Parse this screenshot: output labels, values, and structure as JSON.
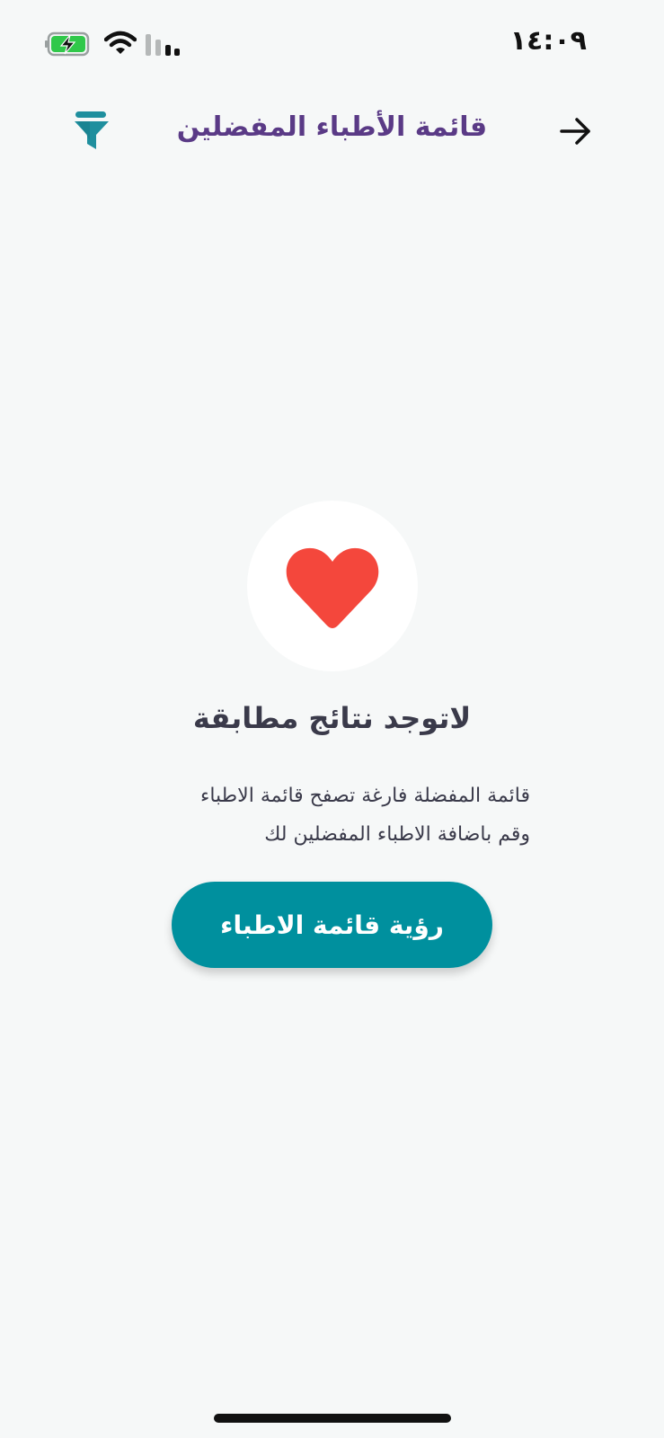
{
  "status_bar": {
    "time": "١٤:٠٩",
    "battery_icon": "battery-charging-icon",
    "wifi_icon": "wifi-icon",
    "signal_icon": "cellular-signal-icon"
  },
  "header": {
    "title": "قائمة الأطباء المفضلين",
    "filter_icon": "filter-icon",
    "back_icon": "arrow-right-icon"
  },
  "empty_state": {
    "icon": "heart-icon",
    "title": "لاتوجد نتائج مطابقة",
    "description_line1": "قائمة المفضلة فارغة تصفح قائمة الاطباء",
    "description_line2": "وقم باضافة الاطباء المفضلين لك",
    "button_label": "رؤية قائمة الاطباء"
  },
  "colors": {
    "background": "#f6f8f8",
    "title": "#5a3a86",
    "accent": "#00909e",
    "heart": "#f4473c",
    "filter": "#1f8f9e"
  }
}
